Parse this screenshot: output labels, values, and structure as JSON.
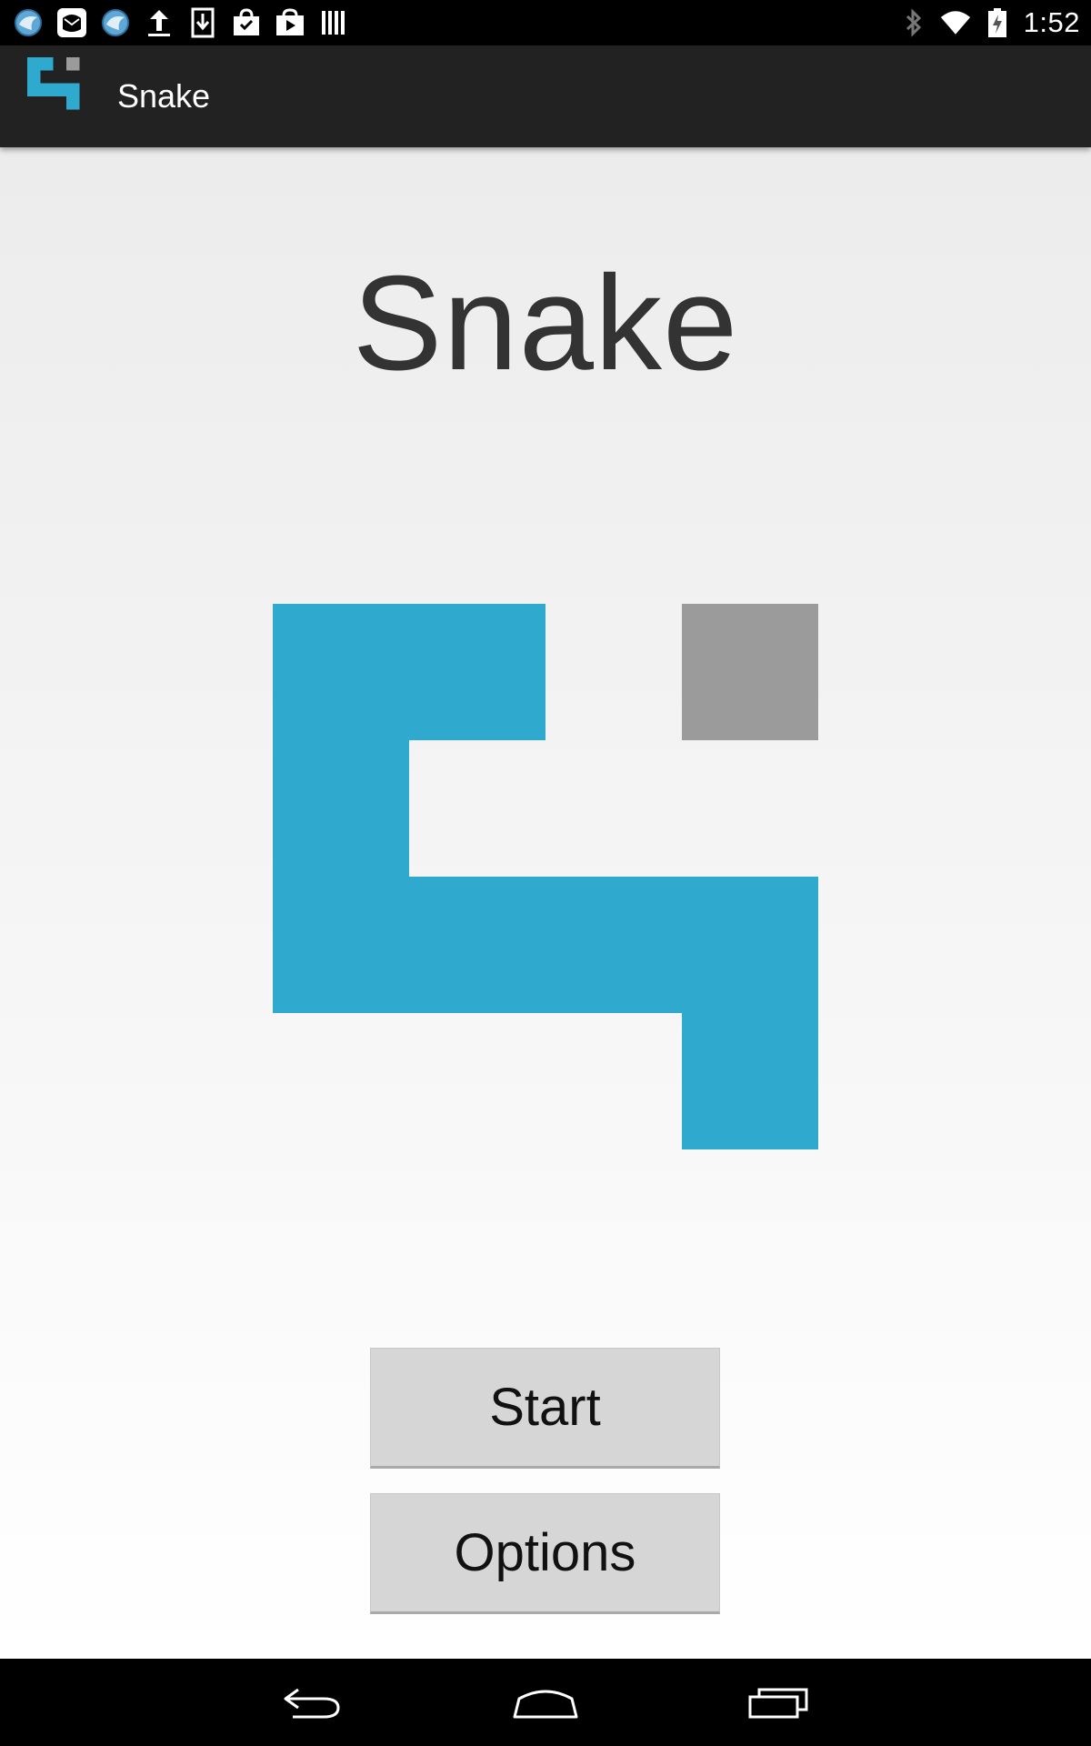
{
  "status_bar": {
    "time": "1:52",
    "notification_icons": [
      "browser-icon",
      "mail-icon",
      "browser-icon",
      "upload-icon",
      "download-icon",
      "shopping-bag-icon",
      "play-store-icon",
      "barcode-icon"
    ],
    "system_icons": [
      "bluetooth-icon",
      "wifi-icon",
      "battery-charging-icon"
    ]
  },
  "action_bar": {
    "title": "Snake",
    "icon": "snake-logo-icon"
  },
  "main": {
    "title": "Snake",
    "logo": "snake-logo-icon"
  },
  "buttons": {
    "start_label": "Start",
    "options_label": "Options"
  },
  "nav_bar": {
    "items": [
      "back-icon",
      "home-icon",
      "recents-icon"
    ]
  },
  "colors": {
    "snake_blue": "#2FA9CD",
    "food_gray": "#9B9B9B",
    "action_bar": "#222222",
    "button_bg": "#D6D6D6"
  }
}
